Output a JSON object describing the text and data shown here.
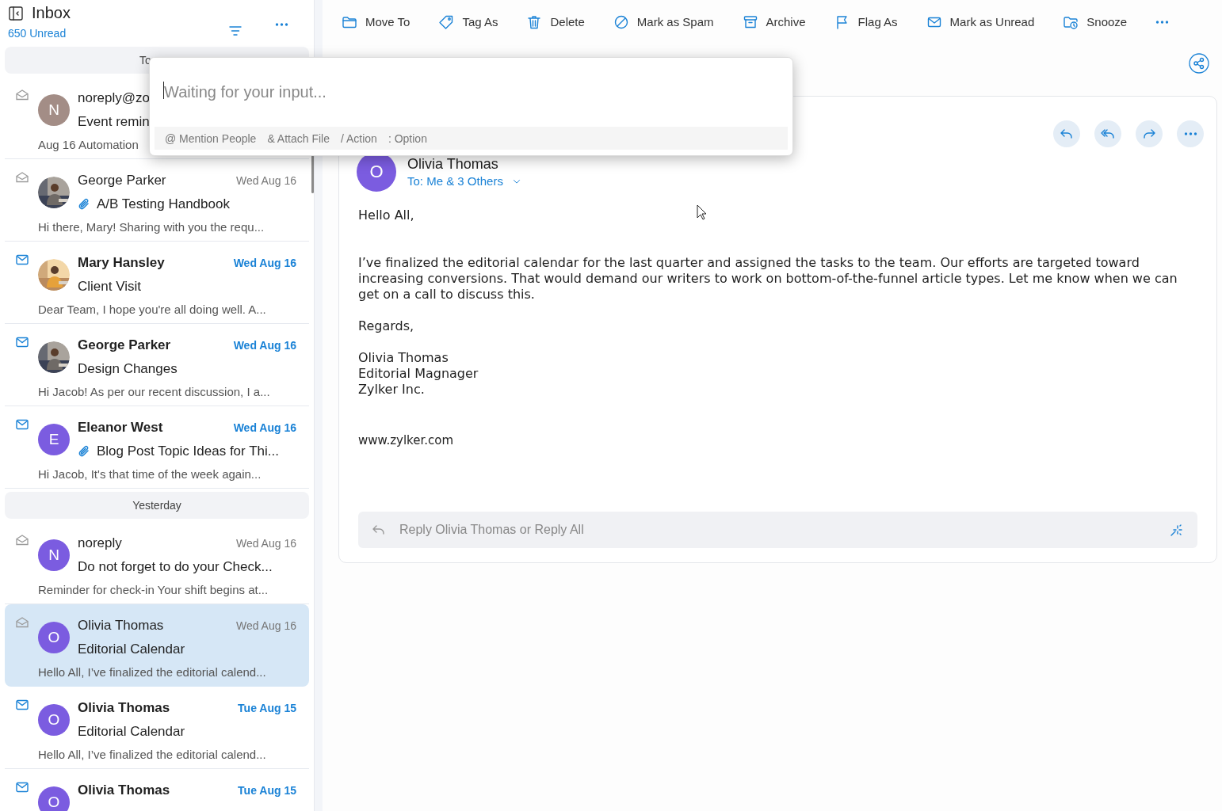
{
  "inbox": {
    "title": "Inbox",
    "unread": "650 Unread"
  },
  "mail_list": [
    {
      "kind": "section",
      "label": "To"
    },
    {
      "kind": "mail",
      "sender": "noreply@zo",
      "subject": "Event remin",
      "preview": "Aug 16 Automation",
      "unread": false,
      "attachment": false,
      "selected": false,
      "avatar": {
        "kind": "letter",
        "letter": "N",
        "color": "#a38d86"
      }
    },
    {
      "kind": "mail",
      "sender": "George Parker",
      "date": "Wed Aug 16",
      "subject": "A/B Testing Handbook",
      "preview": "Hi there, Mary! Sharing with you the requ...",
      "unread": false,
      "attachment": true,
      "selected": false
    },
    {
      "kind": "mail",
      "sender": "Mary Hansley",
      "date": "Wed Aug 16",
      "subject": "Client Visit",
      "preview": "Dear Team, I hope you're all doing well. A...",
      "unread": true,
      "attachment": false,
      "selected": false
    },
    {
      "kind": "mail",
      "sender": "George Parker",
      "date": "Wed Aug 16",
      "subject": "Design Changes",
      "preview": "Hi Jacob! As per our recent discussion, I a...",
      "unread": true,
      "attachment": false,
      "selected": false
    },
    {
      "kind": "mail",
      "sender": "Eleanor West",
      "date": "Wed Aug 16",
      "subject": "Blog Post Topic Ideas for Thi...",
      "preview": "Hi Jacob, It's that time of the week again...",
      "unread": true,
      "attachment": true,
      "selected": false,
      "avatar": {
        "kind": "letter",
        "letter": "E",
        "color": "#7b5ce0"
      }
    },
    {
      "kind": "section",
      "label": "Yesterday"
    },
    {
      "kind": "mail",
      "sender": "noreply",
      "date": "Wed Aug 16",
      "subject": "Do not forget to do your Check...",
      "preview": "Reminder for check-in Your shift begins at...",
      "unread": false,
      "attachment": false,
      "selected": false,
      "avatar": {
        "kind": "letter",
        "letter": "N",
        "color": "#7b5ce0"
      }
    },
    {
      "kind": "mail",
      "sender": "Olivia Thomas",
      "date": "Wed Aug 16",
      "subject": "Editorial Calendar",
      "preview": "Hello All, I’ve finalized the editorial calend...",
      "unread": false,
      "attachment": false,
      "selected": true,
      "avatar": {
        "kind": "letter",
        "letter": "O",
        "color": "#7b5ce0"
      }
    },
    {
      "kind": "mail",
      "sender": "Olivia Thomas",
      "date": "Tue Aug 15",
      "subject": "Editorial Calendar",
      "preview": "Hello All, I’ve finalized the editorial calend...",
      "unread": true,
      "attachment": false,
      "selected": false,
      "avatar": {
        "kind": "letter",
        "letter": "O",
        "color": "#7b5ce0"
      }
    },
    {
      "kind": "mail",
      "sender": "Olivia Thomas",
      "date": "Tue Aug 15",
      "unread": true,
      "selected": false,
      "avatar": {
        "kind": "letter",
        "letter": "O",
        "color": "#7b5ce0"
      }
    }
  ],
  "toolbar": [
    {
      "kind": "folder",
      "label": "Move To"
    },
    {
      "kind": "tag",
      "label": "Tag As"
    },
    {
      "kind": "trash",
      "label": "Delete"
    },
    {
      "kind": "spam",
      "label": "Mark as Spam"
    },
    {
      "kind": "archive",
      "label": "Archive"
    },
    {
      "kind": "flag",
      "label": "Flag As"
    },
    {
      "kind": "envelope",
      "label": "Mark as Unread"
    },
    {
      "kind": "snooze",
      "label": "Snooze"
    },
    {
      "kind": "more"
    }
  ],
  "message": {
    "avatar_letter": "O",
    "sender": "Olivia Thomas",
    "to": "To: Me & 3 Others",
    "body": [
      "Hello All,",
      "I’ve finalized the editorial calendar for the last quarter and assigned the tasks to the team. Our efforts are targeted toward increasing conversions. That would demand our writers to work on bottom-of-the-funnel article types. Let me know when we can get on a call to discuss this.",
      "Regards,",
      "Olivia Thomas\nEditorial Magnager\nZylker Inc."
    ],
    "link": "www.zylker.com",
    "reply_placeholder": "Reply Olivia Thomas or Reply All"
  },
  "command_popup": {
    "placeholder": "Waiting for your input...",
    "hints": [
      "@ Mention People",
      "& Attach File",
      "/ Action",
      ": Option"
    ]
  }
}
